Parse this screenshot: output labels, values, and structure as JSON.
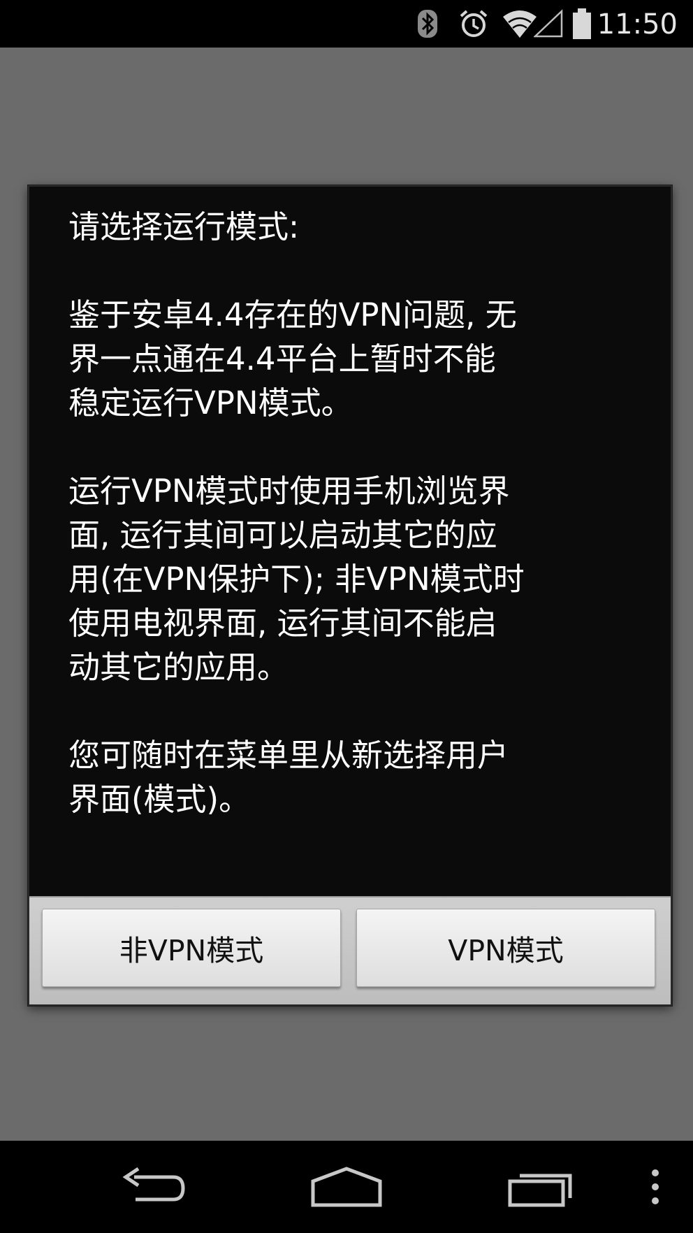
{
  "status_bar": {
    "time": "11:50",
    "icons": [
      "bluetooth-icon",
      "alarm-icon",
      "wifi-icon",
      "signal-icon",
      "battery-icon"
    ]
  },
  "dialog": {
    "paragraphs": [
      "请选择运行模式:",
      "鉴于安卓4.4存在的VPN问题, 无\n界一点通在4.4平台上暂时不能\n稳定运行VPN模式。",
      "运行VPN模式时使用手机浏览界\n面, 运行其间可以启动其它的应\n用(在VPN保护下); 非VPN模式时\n使用电视界面, 运行其间不能启\n动其它的应用。",
      "您可随时在菜单里从新选择用户\n界面(模式)。"
    ],
    "buttons": {
      "non_vpn": "非VPN模式",
      "vpn": "VPN模式"
    }
  },
  "nav_bar": {
    "icons": [
      "back-icon",
      "home-icon",
      "recents-icon",
      "overflow-menu-icon"
    ]
  },
  "colors": {
    "dim_background": "#6b6b6b",
    "dialog_background": "#0b0b0b",
    "button_bar": "#c8c8c8"
  }
}
